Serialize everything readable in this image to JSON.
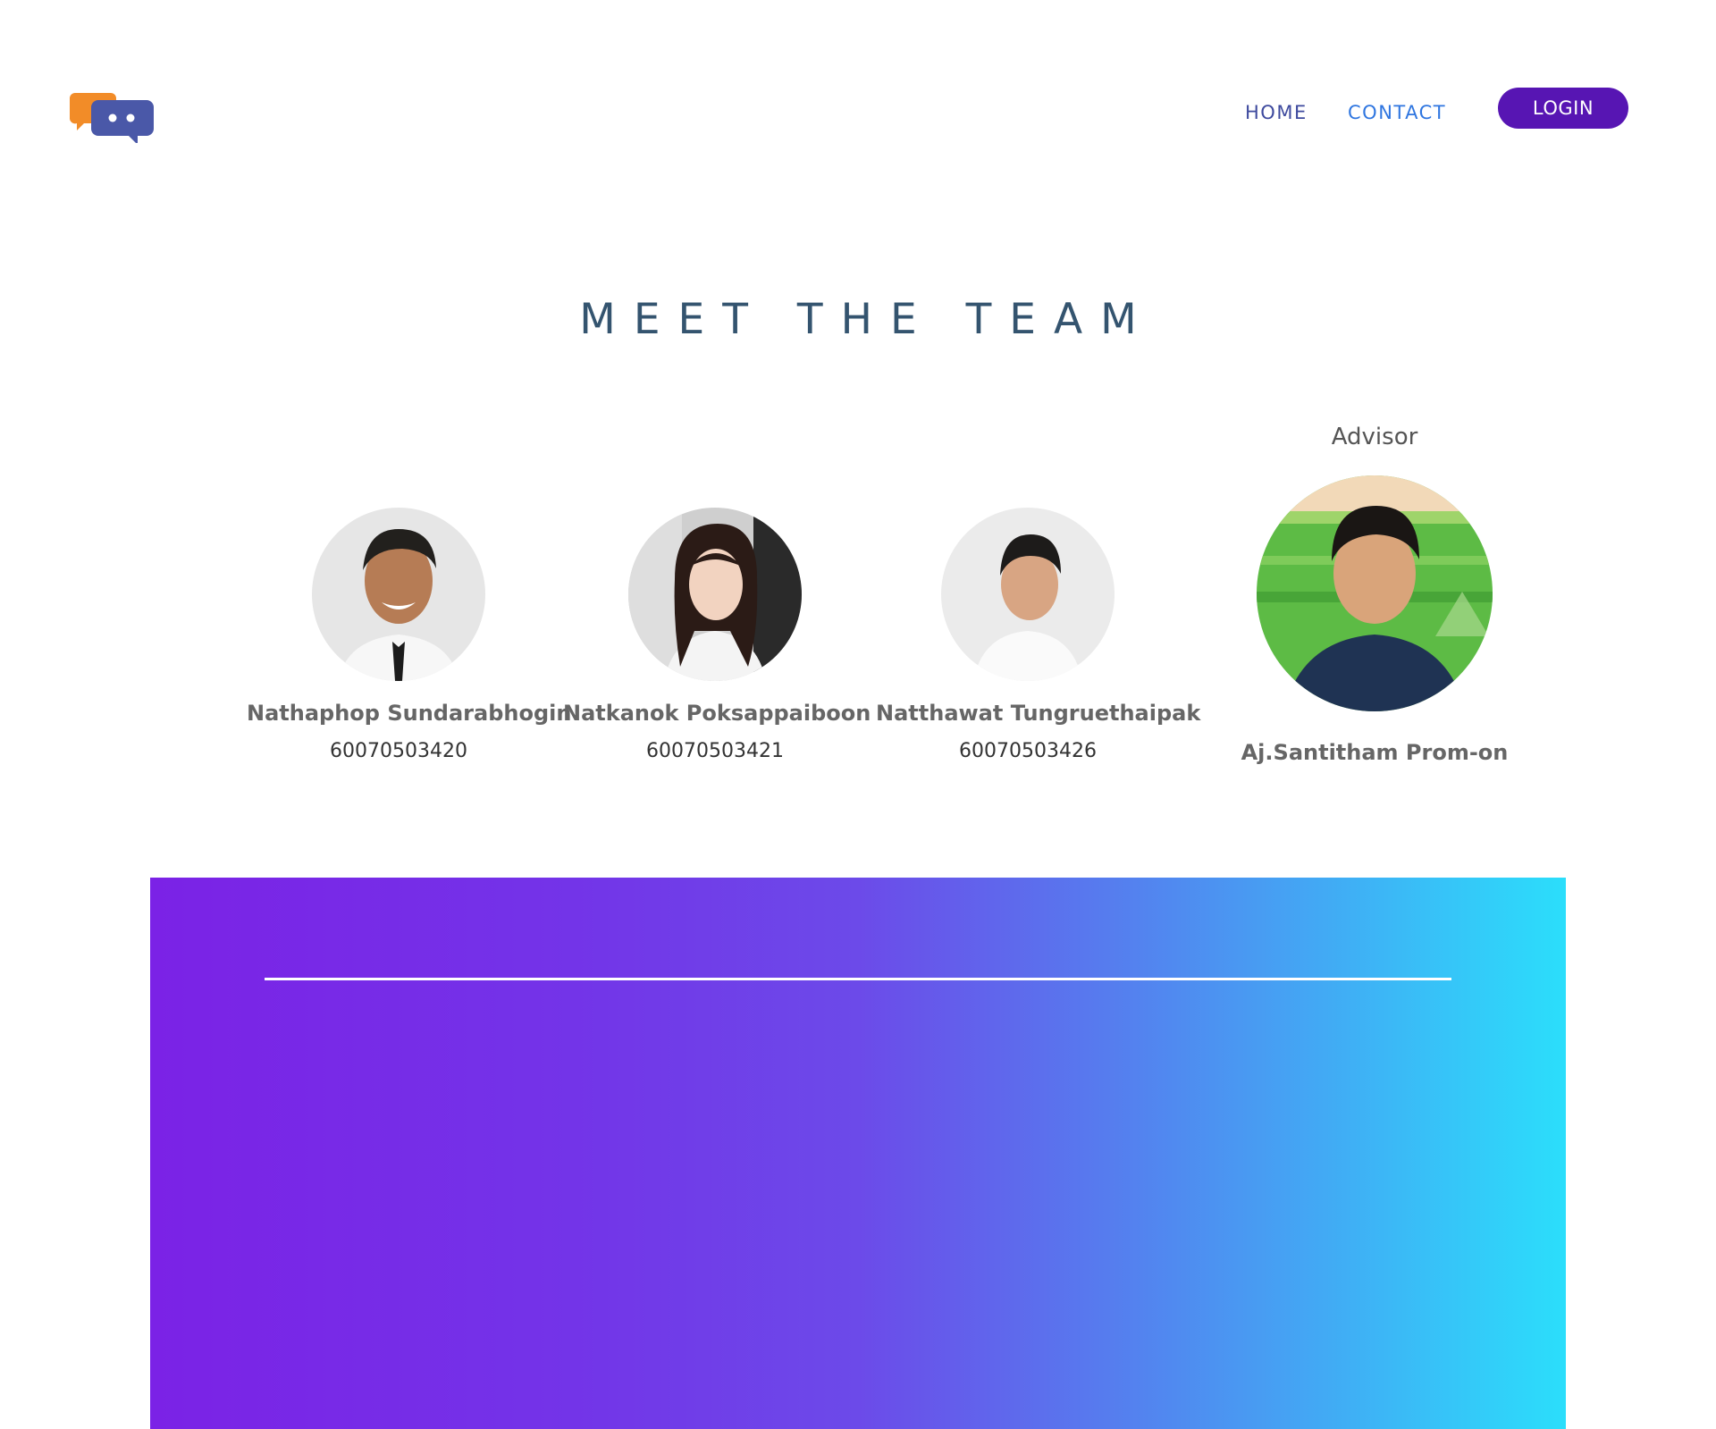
{
  "nav": {
    "home_label": "HOME",
    "contact_label": "CONTACT",
    "login_label": "LOGIN"
  },
  "brand": {
    "logo_icon": "chat-bubbles-icon",
    "colors": {
      "orange": "#f28c28",
      "blue": "#4a58a8"
    }
  },
  "section": {
    "title": "MEET THE TEAM"
  },
  "team": [
    {
      "name": "Nathaphop Sundarabhogin",
      "student_id": "60070503420"
    },
    {
      "name": "Natkanok Poksappaiboon",
      "student_id": "60070503421"
    },
    {
      "name": "Natthawat Tungruethaipak",
      "student_id": "60070503426"
    }
  ],
  "advisor": {
    "label": "Advisor",
    "name": "Aj.Santitham Prom-on"
  },
  "theme": {
    "login_bg": "#5715b3",
    "title_color": "#34546f",
    "gradient_start": "#7b22e6",
    "gradient_end": "#2bdefb"
  }
}
